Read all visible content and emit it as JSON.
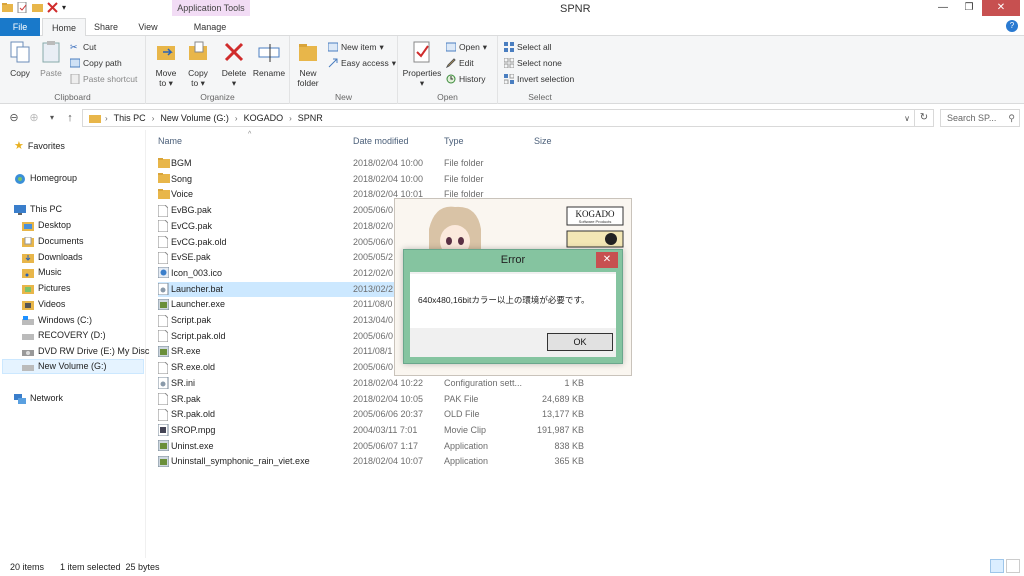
{
  "window": {
    "title": "SPNR",
    "contextual_tab": "Application Tools"
  },
  "tabs": {
    "file": "File",
    "home": "Home",
    "share": "Share",
    "view": "View",
    "manage": "Manage"
  },
  "ribbon": {
    "clipboard": {
      "copy": "Copy",
      "paste": "Paste",
      "cut": "Cut",
      "copy_path": "Copy path",
      "paste_shortcut": "Paste shortcut",
      "label": "Clipboard"
    },
    "organize": {
      "move_to_1": "Move",
      "move_to_2": "to",
      "copy_to_1": "Copy",
      "copy_to_2": "to",
      "delete": "Delete",
      "rename": "Rename",
      "label": "Organize"
    },
    "new": {
      "new_folder_1": "New",
      "new_folder_2": "folder",
      "new_item": "New item",
      "easy_access": "Easy access",
      "label": "New"
    },
    "open": {
      "properties": "Properties",
      "open": "Open",
      "edit": "Edit",
      "history": "History",
      "label": "Open"
    },
    "select": {
      "select_all": "Select all",
      "select_none": "Select none",
      "invert_selection": "Invert selection",
      "label": "Select"
    }
  },
  "address": {
    "crumbs": [
      "This PC",
      "New Volume (G:)",
      "KOGADO",
      "SPNR"
    ],
    "search_placeholder": "Search SP..."
  },
  "nav": {
    "favorites": "Favorites",
    "homegroup": "Homegroup",
    "this_pc": "This PC",
    "desktop": "Desktop",
    "documents": "Documents",
    "downloads": "Downloads",
    "music": "Music",
    "pictures": "Pictures",
    "videos": "Videos",
    "windows_c": "Windows (C:)",
    "recovery_d": "RECOVERY (D:)",
    "dvd_e": "DVD RW Drive (E:) My Disc",
    "new_volume_g": "New Volume (G:)",
    "network": "Network"
  },
  "columns": {
    "name": "Name",
    "date": "Date modified",
    "type": "Type",
    "size": "Size"
  },
  "files": [
    {
      "name": "BGM",
      "date": "2018/02/04 10:00",
      "type": "File folder",
      "size": ""
    },
    {
      "name": "Song",
      "date": "2018/02/04 10:00",
      "type": "File folder",
      "size": ""
    },
    {
      "name": "Voice",
      "date": "2018/02/04 10:01",
      "type": "File folder",
      "size": ""
    },
    {
      "name": "EvBG.pak",
      "date": "2005/06/0",
      "type": "",
      "size": ""
    },
    {
      "name": "EvCG.pak",
      "date": "2018/02/0",
      "type": "",
      "size": ""
    },
    {
      "name": "EvCG.pak.old",
      "date": "2005/06/0",
      "type": "",
      "size": ""
    },
    {
      "name": "EvSE.pak",
      "date": "2005/05/2",
      "type": "",
      "size": ""
    },
    {
      "name": "Icon_003.ico",
      "date": "2012/02/0",
      "type": "",
      "size": ""
    },
    {
      "name": "Launcher.bat",
      "date": "2013/02/2",
      "type": "",
      "size": ""
    },
    {
      "name": "Launcher.exe",
      "date": "2011/08/0",
      "type": "",
      "size": ""
    },
    {
      "name": "Script.pak",
      "date": "2013/04/0",
      "type": "",
      "size": ""
    },
    {
      "name": "Script.pak.old",
      "date": "2005/06/0",
      "type": "",
      "size": ""
    },
    {
      "name": "SR.exe",
      "date": "2011/08/1",
      "type": "",
      "size": ""
    },
    {
      "name": "SR.exe.old",
      "date": "2005/06/0",
      "type": "",
      "size": ""
    },
    {
      "name": "SR.ini",
      "date": "2018/02/04 10:22",
      "type": "Configuration sett...",
      "size": "1 KB"
    },
    {
      "name": "SR.pak",
      "date": "2018/02/04 10:05",
      "type": "PAK File",
      "size": "24,689 KB"
    },
    {
      "name": "SR.pak.old",
      "date": "2005/06/06 20:37",
      "type": "OLD File",
      "size": "13,177 KB"
    },
    {
      "name": "SROP.mpg",
      "date": "2004/03/11 7:01",
      "type": "Movie Clip",
      "size": "191,987 KB"
    },
    {
      "name": "Uninst.exe",
      "date": "2005/06/07 1:17",
      "type": "Application",
      "size": "838 KB"
    },
    {
      "name": "Uninstall_symphonic_rain_viet.exe",
      "date": "2018/02/04 10:07",
      "type": "Application",
      "size": "365 KB"
    }
  ],
  "splash": {
    "logo": "KOGADO",
    "logo_sub": "Software Products"
  },
  "dialog": {
    "title": "Error",
    "message": "640x480,16bitカラー以上の環境が必要です。",
    "ok": "OK"
  },
  "status": {
    "items": "20 items",
    "selected": "1 item selected  25 bytes"
  }
}
